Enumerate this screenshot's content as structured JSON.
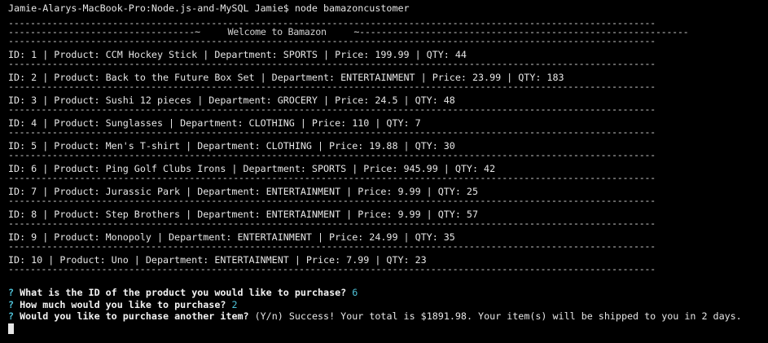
{
  "shell": {
    "prompt_line": "Jamie-Alarys-MacBook-Pro:Node.js-and-MySQL Jamie$ node bamazoncustomer"
  },
  "banner": {
    "separator": "----------------------------------------------------------------------------------------------------------------------",
    "welcome_line": "----------------------------------~     Welcome to Bamazon     ~------------------------------------------------------------"
  },
  "products": [
    {
      "row": "ID: 1 | Product: CCM Hockey Stick | Department: SPORTS | Price: 199.99 | QTY: 44"
    },
    {
      "row": "ID: 2 | Product: Back to the Future Box Set | Department: ENTERTAINMENT | Price: 23.99 | QTY: 183"
    },
    {
      "row": "ID: 3 | Product: Sushi 12 pieces | Department: GROCERY | Price: 24.5 | QTY: 48"
    },
    {
      "row": "ID: 4 | Product: Sunglasses | Department: CLOTHING | Price: 110 | QTY: 7"
    },
    {
      "row": "ID: 5 | Product: Men's T-shirt | Department: CLOTHING | Price: 19.88 | QTY: 30"
    },
    {
      "row": "ID: 6 | Product: Ping Golf Clubs Irons | Department: SPORTS | Price: 945.99 | QTY: 42"
    },
    {
      "row": "ID: 7 | Product: Jurassic Park | Department: ENTERTAINMENT | Price: 9.99 | QTY: 25"
    },
    {
      "row": "ID: 8 | Product: Step Brothers | Department: ENTERTAINMENT | Price: 9.99 | QTY: 57"
    },
    {
      "row": "ID: 9 | Product: Monopoly | Department: ENTERTAINMENT | Price: 24.99 | QTY: 35"
    },
    {
      "row": "ID: 10 | Product: Uno | Department: ENTERTAINMENT | Price: 7.99 | QTY: 23"
    }
  ],
  "prompts": {
    "mark": "?",
    "q1": "What is the ID of the product you would like to purchase?",
    "a1": "6",
    "q2": "How much would you like to purchase?",
    "a2": "2",
    "q3": "Would you like to purchase another item?",
    "q3_hint": "(Y/n) Success! Your total is $1891.98. Your item(s) will be shipped to you in 2 days."
  },
  "colors": {
    "background": "#000000",
    "text": "#e6e6e6",
    "accent": "#4fc3d9"
  }
}
